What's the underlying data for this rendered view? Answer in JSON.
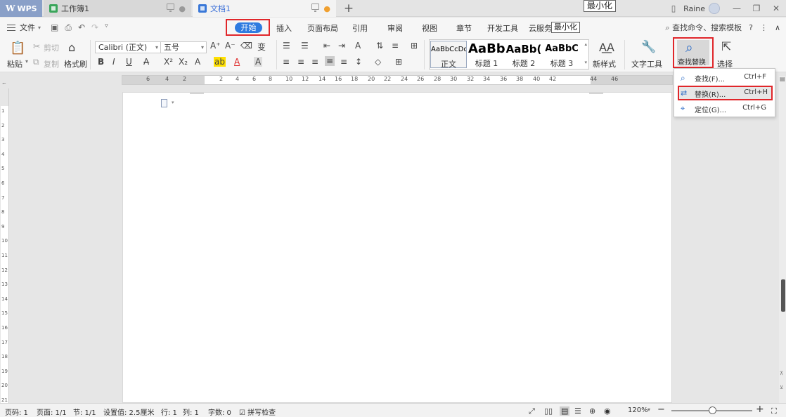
{
  "titlebar": {
    "app_tab": "WPS",
    "tabs": [
      "工作簿1",
      "文档1"
    ],
    "tooltip": "最小化",
    "user": "Raine"
  },
  "menubar": {
    "file": "文件",
    "tabs": [
      "开始",
      "插入",
      "页面布局",
      "引用",
      "审阅",
      "视图",
      "章节",
      "开发工具",
      "云服务"
    ],
    "tooltip": "最小化",
    "search": "查找命令、搜索模板"
  },
  "ribbon": {
    "paste": "粘贴",
    "cut": "剪切",
    "copy": "复制",
    "format_painter": "格式刷",
    "font_name": "Calibri (正文)",
    "font_size": "五号",
    "styles": [
      {
        "preview": "AaBbCcDd",
        "name": "正文"
      },
      {
        "preview": "AaBb",
        "name": "标题 1"
      },
      {
        "preview": "AaBb(",
        "name": "标题 2"
      },
      {
        "preview": "AaBbC",
        "name": "标题 3"
      }
    ],
    "new_style": "新样式",
    "text_tools": "文字工具",
    "find_replace": "查找替换",
    "select": "选择"
  },
  "dropdown": {
    "items": [
      {
        "label": "查找(F)...",
        "shortcut": "Ctrl+F"
      },
      {
        "label": "替换(R)...",
        "shortcut": "Ctrl+H"
      },
      {
        "label": "定位(G)...",
        "shortcut": "Ctrl+G"
      }
    ]
  },
  "ruler": {
    "h_labels": [
      "6",
      "4",
      "2",
      "2",
      "4",
      "6",
      "8",
      "10",
      "12",
      "14",
      "16",
      "18",
      "20",
      "22",
      "24",
      "26",
      "28",
      "30",
      "32",
      "34",
      "36",
      "38",
      "40",
      "42",
      "44",
      "46"
    ],
    "v_labels": [
      "1",
      "2",
      "3",
      "4",
      "5",
      "6",
      "7",
      "8",
      "9",
      "10",
      "11",
      "12",
      "13",
      "14",
      "15",
      "16",
      "17",
      "18",
      "19",
      "20",
      "21"
    ]
  },
  "status": {
    "page_no": "页码: 1",
    "pages": "页面: 1/1",
    "section": "节: 1/1",
    "setting": "设置值: 2.5厘米",
    "row": "行: 1",
    "col": "列: 1",
    "words": "字数: 0",
    "spell": "拼写检查",
    "zoom": "120%"
  },
  "colors": {
    "accent": "#2f7be0",
    "highlight": "#e0262a"
  }
}
